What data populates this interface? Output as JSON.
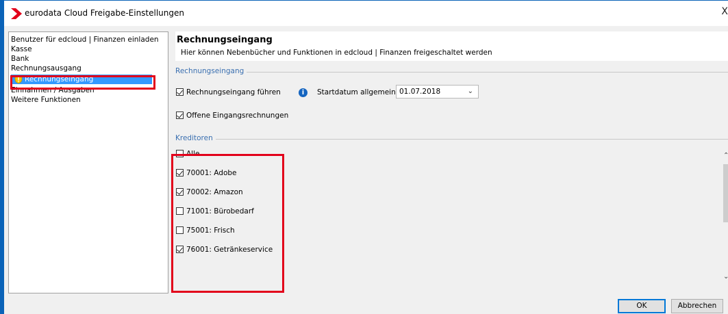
{
  "window": {
    "title": "eurodata Cloud Freigabe-Einstellungen",
    "close_label": "X"
  },
  "nav": {
    "items": [
      {
        "label": "Benutzer für edcloud | Finanzen einladen"
      },
      {
        "label": "Kasse"
      },
      {
        "label": "Bank"
      },
      {
        "label": "Rechnungsausgang"
      },
      {
        "label": "Rechnungseingang",
        "selected": true
      },
      {
        "label": "Einnahmen / Ausgaben"
      },
      {
        "label": "Weitere Funktionen"
      }
    ]
  },
  "content": {
    "title": "Rechnungseingang",
    "subtitle": "Hier können Nebenbücher und Funktionen in edcloud | Finanzen freigeschaltet werden",
    "group_rechnung": {
      "title": "Rechnungseingang",
      "fuehren_label": "Rechnungseingang führen",
      "fuehren_checked": true,
      "startdatum_label": "Startdatum allgemein:",
      "startdatum_value": "01.07.2018",
      "offene_label": "Offene Eingangsrechnungen",
      "offene_checked": true
    },
    "group_kreditoren": {
      "title": "Kreditoren",
      "items": [
        {
          "label": "Alle",
          "checked": false
        },
        {
          "label": "70001: Adobe",
          "checked": true
        },
        {
          "label": "70002: Amazon",
          "checked": true
        },
        {
          "label": "71001: Bürobedarf",
          "checked": false
        },
        {
          "label": "75001: Frisch",
          "checked": false
        },
        {
          "label": "76001: Getränkeservice",
          "checked": true
        }
      ]
    }
  },
  "buttons": {
    "ok": "OK",
    "cancel": "Abbrechen"
  },
  "colors": {
    "highlight": "#e2001a",
    "selection": "#3399ff",
    "frame": "#0b63b8"
  }
}
